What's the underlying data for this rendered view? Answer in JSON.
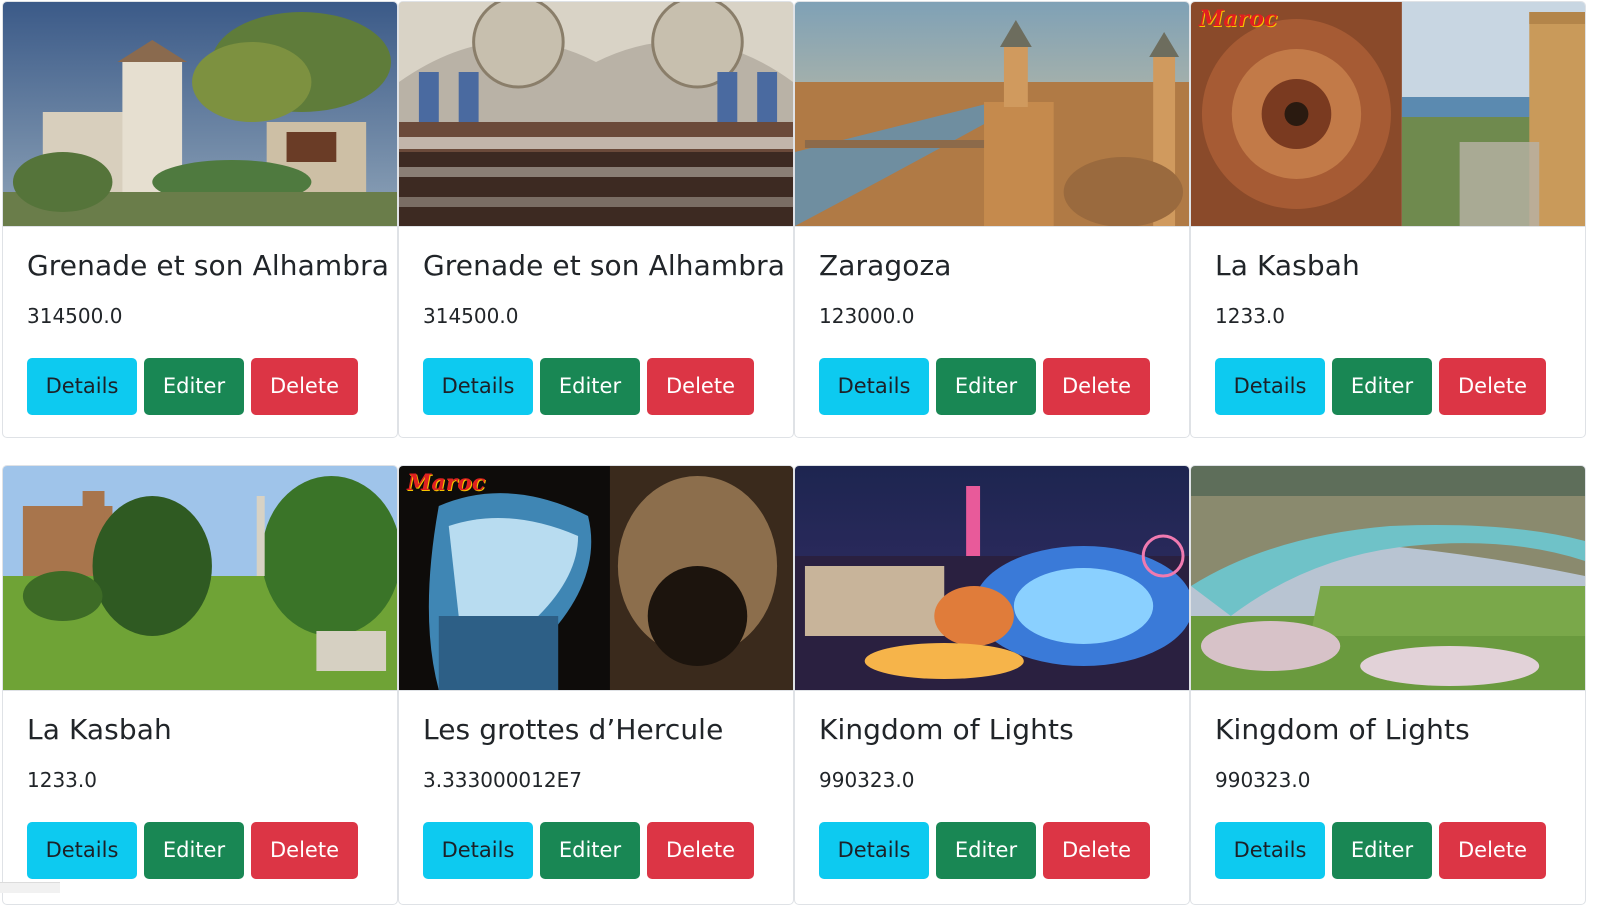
{
  "cards": [
    {
      "title": "Grenade et son Alhambra",
      "price": "314500.0",
      "image": "garden-palace-photo"
    },
    {
      "title": "Grenade et son Alhambra",
      "price": "314500.0",
      "image": "mosque-interior-photo"
    },
    {
      "title": "Zaragoza",
      "price": "123000.0",
      "image": "city-river-aerial-photo"
    },
    {
      "title": "La Kasbah",
      "price": "1233.0",
      "image": "kasbah-ceiling-fortress-photo",
      "logo": "Maroc"
    },
    {
      "title": "La Kasbah",
      "price": "1233.0",
      "image": "english-park-estate-photo"
    },
    {
      "title": "Les grottes d’Hercule",
      "price": "3.333000012E7",
      "image": "sea-cave-photo",
      "logo": "Maroc"
    },
    {
      "title": "Kingdom of Lights",
      "price": "990323.0",
      "image": "illuminated-theme-park-photo"
    },
    {
      "title": "Kingdom of Lights",
      "price": "990323.0",
      "image": "valley-river-blossom-photo"
    }
  ],
  "buttons": {
    "details": "Details",
    "edit": "Editer",
    "delete": "Delete"
  },
  "colors": {
    "details": "#0dcaf0",
    "edit": "#198754",
    "delete": "#dc3545",
    "border": "#dfe2e6"
  }
}
